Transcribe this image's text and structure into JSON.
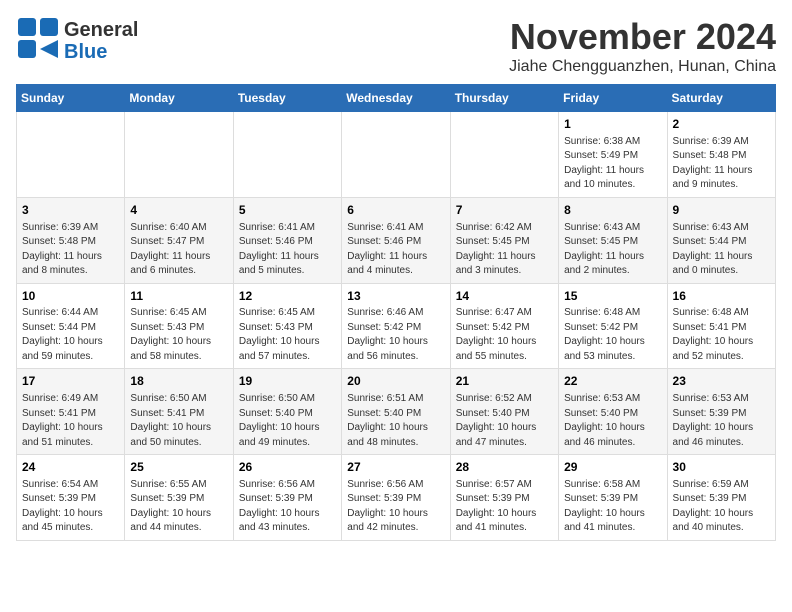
{
  "header": {
    "logo_line1": "General",
    "logo_line2": "Blue",
    "month": "November 2024",
    "location": "Jiahe Chengguanzhen, Hunan, China"
  },
  "weekdays": [
    "Sunday",
    "Monday",
    "Tuesday",
    "Wednesday",
    "Thursday",
    "Friday",
    "Saturday"
  ],
  "weeks": [
    [
      {
        "day": "",
        "info": ""
      },
      {
        "day": "",
        "info": ""
      },
      {
        "day": "",
        "info": ""
      },
      {
        "day": "",
        "info": ""
      },
      {
        "day": "",
        "info": ""
      },
      {
        "day": "1",
        "info": "Sunrise: 6:38 AM\nSunset: 5:49 PM\nDaylight: 11 hours\nand 10 minutes."
      },
      {
        "day": "2",
        "info": "Sunrise: 6:39 AM\nSunset: 5:48 PM\nDaylight: 11 hours\nand 9 minutes."
      }
    ],
    [
      {
        "day": "3",
        "info": "Sunrise: 6:39 AM\nSunset: 5:48 PM\nDaylight: 11 hours\nand 8 minutes."
      },
      {
        "day": "4",
        "info": "Sunrise: 6:40 AM\nSunset: 5:47 PM\nDaylight: 11 hours\nand 6 minutes."
      },
      {
        "day": "5",
        "info": "Sunrise: 6:41 AM\nSunset: 5:46 PM\nDaylight: 11 hours\nand 5 minutes."
      },
      {
        "day": "6",
        "info": "Sunrise: 6:41 AM\nSunset: 5:46 PM\nDaylight: 11 hours\nand 4 minutes."
      },
      {
        "day": "7",
        "info": "Sunrise: 6:42 AM\nSunset: 5:45 PM\nDaylight: 11 hours\nand 3 minutes."
      },
      {
        "day": "8",
        "info": "Sunrise: 6:43 AM\nSunset: 5:45 PM\nDaylight: 11 hours\nand 2 minutes."
      },
      {
        "day": "9",
        "info": "Sunrise: 6:43 AM\nSunset: 5:44 PM\nDaylight: 11 hours\nand 0 minutes."
      }
    ],
    [
      {
        "day": "10",
        "info": "Sunrise: 6:44 AM\nSunset: 5:44 PM\nDaylight: 10 hours\nand 59 minutes."
      },
      {
        "day": "11",
        "info": "Sunrise: 6:45 AM\nSunset: 5:43 PM\nDaylight: 10 hours\nand 58 minutes."
      },
      {
        "day": "12",
        "info": "Sunrise: 6:45 AM\nSunset: 5:43 PM\nDaylight: 10 hours\nand 57 minutes."
      },
      {
        "day": "13",
        "info": "Sunrise: 6:46 AM\nSunset: 5:42 PM\nDaylight: 10 hours\nand 56 minutes."
      },
      {
        "day": "14",
        "info": "Sunrise: 6:47 AM\nSunset: 5:42 PM\nDaylight: 10 hours\nand 55 minutes."
      },
      {
        "day": "15",
        "info": "Sunrise: 6:48 AM\nSunset: 5:42 PM\nDaylight: 10 hours\nand 53 minutes."
      },
      {
        "day": "16",
        "info": "Sunrise: 6:48 AM\nSunset: 5:41 PM\nDaylight: 10 hours\nand 52 minutes."
      }
    ],
    [
      {
        "day": "17",
        "info": "Sunrise: 6:49 AM\nSunset: 5:41 PM\nDaylight: 10 hours\nand 51 minutes."
      },
      {
        "day": "18",
        "info": "Sunrise: 6:50 AM\nSunset: 5:41 PM\nDaylight: 10 hours\nand 50 minutes."
      },
      {
        "day": "19",
        "info": "Sunrise: 6:50 AM\nSunset: 5:40 PM\nDaylight: 10 hours\nand 49 minutes."
      },
      {
        "day": "20",
        "info": "Sunrise: 6:51 AM\nSunset: 5:40 PM\nDaylight: 10 hours\nand 48 minutes."
      },
      {
        "day": "21",
        "info": "Sunrise: 6:52 AM\nSunset: 5:40 PM\nDaylight: 10 hours\nand 47 minutes."
      },
      {
        "day": "22",
        "info": "Sunrise: 6:53 AM\nSunset: 5:40 PM\nDaylight: 10 hours\nand 46 minutes."
      },
      {
        "day": "23",
        "info": "Sunrise: 6:53 AM\nSunset: 5:39 PM\nDaylight: 10 hours\nand 46 minutes."
      }
    ],
    [
      {
        "day": "24",
        "info": "Sunrise: 6:54 AM\nSunset: 5:39 PM\nDaylight: 10 hours\nand 45 minutes."
      },
      {
        "day": "25",
        "info": "Sunrise: 6:55 AM\nSunset: 5:39 PM\nDaylight: 10 hours\nand 44 minutes."
      },
      {
        "day": "26",
        "info": "Sunrise: 6:56 AM\nSunset: 5:39 PM\nDaylight: 10 hours\nand 43 minutes."
      },
      {
        "day": "27",
        "info": "Sunrise: 6:56 AM\nSunset: 5:39 PM\nDaylight: 10 hours\nand 42 minutes."
      },
      {
        "day": "28",
        "info": "Sunrise: 6:57 AM\nSunset: 5:39 PM\nDaylight: 10 hours\nand 41 minutes."
      },
      {
        "day": "29",
        "info": "Sunrise: 6:58 AM\nSunset: 5:39 PM\nDaylight: 10 hours\nand 41 minutes."
      },
      {
        "day": "30",
        "info": "Sunrise: 6:59 AM\nSunset: 5:39 PM\nDaylight: 10 hours\nand 40 minutes."
      }
    ]
  ]
}
